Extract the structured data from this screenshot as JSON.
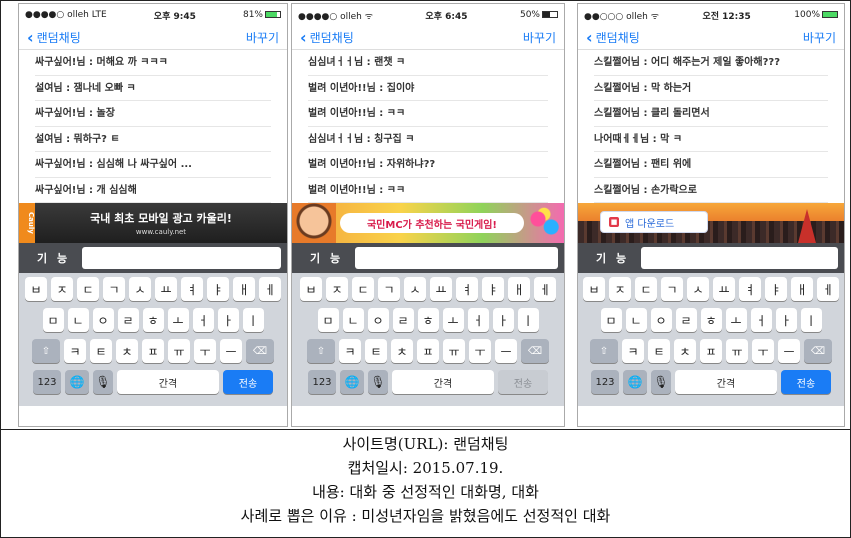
{
  "screens": [
    {
      "status": {
        "carrier": "●●●●○ olleh  LTE",
        "time": "오후 9:45",
        "battery": "81%",
        "battery_level": 0.81
      },
      "nav": {
        "back": "랜덤채팅",
        "change": "바꾸기"
      },
      "messages": [
        "싸구싶어!님 : 머해요 까 ㅋㅋㅋ",
        "설여님 : 잼나네 오빠 ㅋ",
        "싸구싶어!님 : 놀장",
        "설여님 : 뭐하구? ㅌ",
        "싸구싶어!님 : 심심해 나 싸구싶어 ...",
        "싸구싶어!님 : 개 심심해"
      ],
      "ad": {
        "tag": "Cauly",
        "title": "국내 최초 모바일 광고 카울리!",
        "url": "www.cauly.net"
      },
      "input_label": "기 능",
      "send": "전송",
      "send_active": true
    },
    {
      "status": {
        "carrier": "●●●●○ olleh ᯤ",
        "time": "오후 6:45",
        "battery": "50%",
        "battery_level": 0.5
      },
      "nav": {
        "back": "랜덤채팅",
        "change": "바꾸기"
      },
      "messages": [
        "심심녀ㅓㅓ님 : 랜챗 ㅋ",
        "벌려 이년아!!님 : 집이야",
        "벌려 이년아!!님 : ㅋㅋ",
        "심심녀ㅓㅓ님 : 칭구집 ㅋ",
        "벌려 이년아!!님 : 자위하냐??",
        "벌려 이년아!!님 : ㅋㅋ"
      ],
      "ad": {
        "banner": "국민MC가 추천하는 국민게임!"
      },
      "input_label": "기 능",
      "send": "전송",
      "send_active": false
    },
    {
      "status": {
        "carrier": "●●○○○ olleh ᯤ",
        "time": "오전 12:35",
        "battery": "100%",
        "battery_level": 1.0
      },
      "nav": {
        "back": "랜덤채팅",
        "change": "바꾸기"
      },
      "messages": [
        "스킬쩔어님 : 어디 해주는거 제일 좋아해???",
        "스킬쩔어님 : 막 하는거",
        "스킬쩔어님 : 클리 돌리면서",
        "나어때ㅔㅔ님 : 막 ㅋ",
        "스킬쩔어님 : 팬티 위에",
        "스킬쩔어님 : 손가락으로"
      ],
      "ad": {
        "button": "앱 다운로드"
      },
      "input_label": "기 능",
      "send": "전송",
      "send_active": true
    }
  ],
  "keyboard": {
    "row1": [
      "ㅂ",
      "ㅈ",
      "ㄷ",
      "ㄱ",
      "ㅅ",
      "ㅛ",
      "ㅕ",
      "ㅑ",
      "ㅐ",
      "ㅔ"
    ],
    "row2": [
      "ㅁ",
      "ㄴ",
      "ㅇ",
      "ㄹ",
      "ㅎ",
      "ㅗ",
      "ㅓ",
      "ㅏ",
      "ㅣ"
    ],
    "row3": [
      "ㅋ",
      "ㅌ",
      "ㅊ",
      "ㅍ",
      "ㅠ",
      "ㅜ",
      "ㅡ"
    ],
    "num": "123",
    "space": "간격",
    "shift_icon": "shift-arrow-icon",
    "delete_icon": "backspace-icon",
    "globe_icon": "globe-icon",
    "mic_icon": "microphone-icon"
  },
  "caption": {
    "site": "사이트명(URL): 랜덤채팅",
    "date": "캡처일시: 2015.07.19.",
    "content": "내용: 대화 중 선정적인 대화명, 대화",
    "reason": "사례로 뽑은 이유 : 미성년자임을 밝혔음에도 선정적인 대화"
  },
  "colors": {
    "accent": "#1a7cf5",
    "keyboard_bg": "#d1d5db",
    "inputbar_bg": "#4a4c51"
  }
}
